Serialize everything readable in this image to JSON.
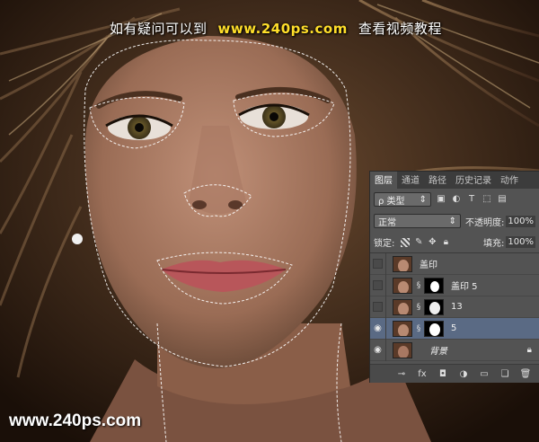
{
  "banner": {
    "prefix": "如有疑问可以到",
    "url": "www.240ps.com",
    "suffix": "查看视频教程"
  },
  "watermark": "www.240ps.com",
  "panel": {
    "tabs": [
      "图层",
      "通道",
      "路径",
      "历史记录",
      "动作"
    ],
    "active_tab": "图层",
    "filter_label": "ρ 类型",
    "blend_mode": "正常",
    "opacity_label": "不透明度:",
    "opacity_value": "100%",
    "lock_label": "锁定:",
    "fill_label": "填充:",
    "fill_value": "100%",
    "layers": [
      {
        "name": "盖印",
        "visible": false,
        "has_mask": false,
        "selected": false
      },
      {
        "name": "盖印 5",
        "visible": false,
        "has_mask": true,
        "selected": false
      },
      {
        "name": "13",
        "visible": false,
        "has_mask": true,
        "selected": false
      },
      {
        "name": "5",
        "visible": true,
        "has_mask": true,
        "selected": true
      },
      {
        "name": "背景",
        "visible": true,
        "has_mask": false,
        "selected": false,
        "locked": true
      }
    ]
  },
  "colors": {
    "panel_bg": "#535353",
    "selected_row": "#5a6a84",
    "banner_url": "#ffde2a"
  }
}
